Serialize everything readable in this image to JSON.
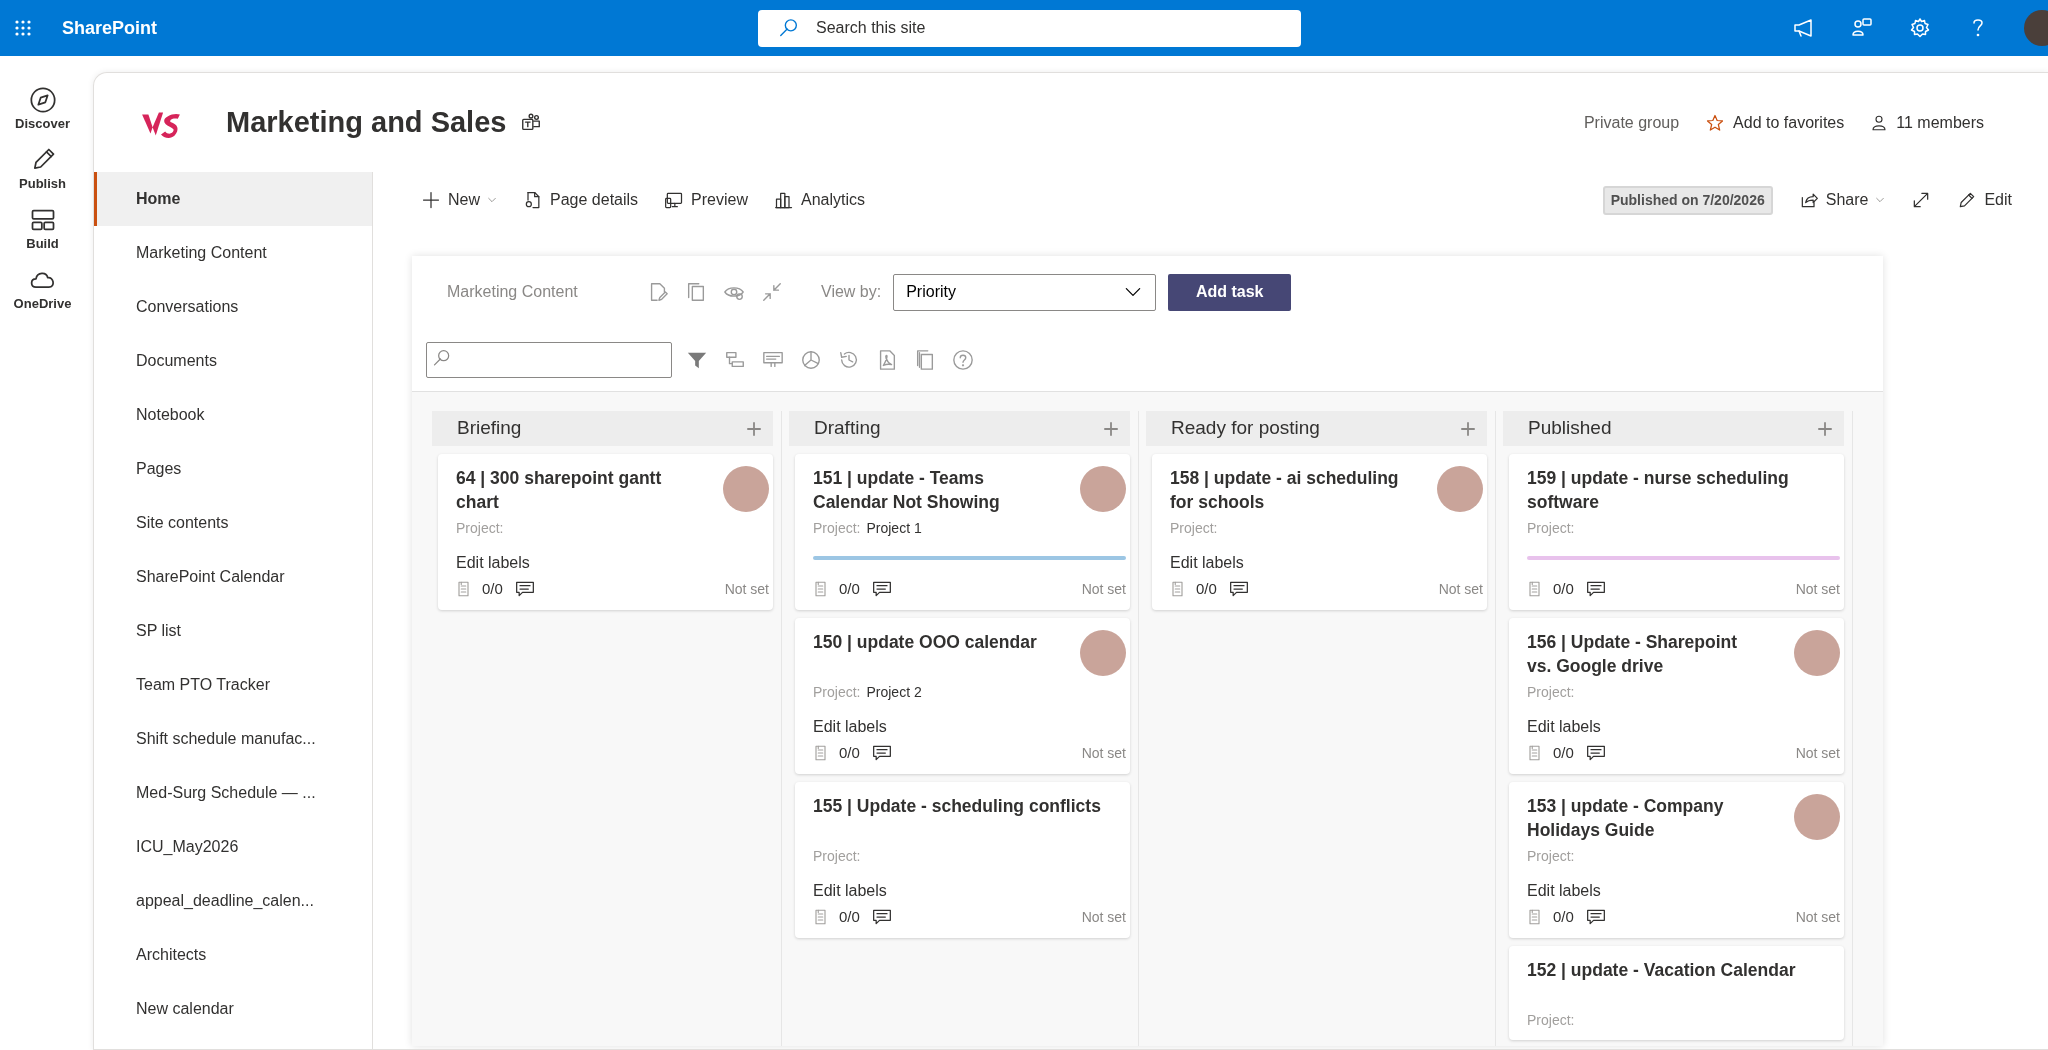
{
  "topbar": {
    "app_name": "SharePoint",
    "search_placeholder": "Search this site"
  },
  "rail": [
    {
      "label": "Discover",
      "kind": "discover"
    },
    {
      "label": "Publish",
      "kind": "publish"
    },
    {
      "label": "Build",
      "kind": "build"
    },
    {
      "label": "OneDrive",
      "kind": "onedrive"
    }
  ],
  "site": {
    "title": "Marketing and Sales",
    "privacy": "Private group",
    "favorite": "Add to favorites",
    "members": "11 members"
  },
  "nav": [
    {
      "label": "Home",
      "selected": true
    },
    {
      "label": "Marketing Content",
      "selected": false
    },
    {
      "label": "Conversations",
      "selected": false
    },
    {
      "label": "Documents",
      "selected": false
    },
    {
      "label": "Notebook",
      "selected": false
    },
    {
      "label": "Pages",
      "selected": false
    },
    {
      "label": "Site contents",
      "selected": false
    },
    {
      "label": "SharePoint Calendar",
      "selected": false
    },
    {
      "label": "SP list",
      "selected": false
    },
    {
      "label": "Team PTO Tracker",
      "selected": false
    },
    {
      "label": "Shift schedule manufac...",
      "selected": false
    },
    {
      "label": "Med-Surg Schedule — ...",
      "selected": false
    },
    {
      "label": "ICU_May2026",
      "selected": false
    },
    {
      "label": "appeal_deadline_calen...",
      "selected": false
    },
    {
      "label": "Architects",
      "selected": false
    },
    {
      "label": "New calendar",
      "selected": false
    }
  ],
  "commands": [
    {
      "label": "New",
      "kind": "new",
      "dropdown": true
    },
    {
      "label": "Page details",
      "kind": "details"
    },
    {
      "label": "Preview",
      "kind": "preview"
    },
    {
      "label": "Analytics",
      "kind": "analytics"
    }
  ],
  "page_status": "Published on 7/20/2026",
  "actions": [
    {
      "label": "Share",
      "kind": "share",
      "dropdown": true
    },
    {
      "kind": "expand"
    },
    {
      "label": "Edit",
      "kind": "edit"
    }
  ],
  "board": {
    "title": "Marketing Content",
    "view_by_label": "View by:",
    "view_by_value": "Priority",
    "add_task": "Add task",
    "columns": [
      {
        "title": "Briefing",
        "cards": [
          {
            "title": "64 | 300 sharepoint gantt chart",
            "avatar": true,
            "project_label": "Project:",
            "edit_labels": "Edit labels",
            "checklist": "0/0",
            "due": "Not set"
          }
        ]
      },
      {
        "title": "Drafting",
        "cards": [
          {
            "title": "151 | update - Teams Calendar Not Showing",
            "avatar": true,
            "project_label": "Project:",
            "project": "Project 1",
            "color": "#9cc6e4",
            "checklist": "0/0",
            "due": "Not set"
          },
          {
            "title": "150 | update OOO calendar",
            "avatar": true,
            "project_label": "Project:",
            "project": "Project 2",
            "edit_labels": "Edit labels",
            "checklist": "0/0",
            "due": "Not set"
          },
          {
            "title": "155 | Update - scheduling conflicts",
            "avatar": false,
            "project_label": "Project:",
            "edit_labels": "Edit labels",
            "checklist": "0/0",
            "due": "Not set"
          }
        ]
      },
      {
        "title": "Ready for posting",
        "cards": [
          {
            "title": "158 | update - ai scheduling for schools",
            "avatar": true,
            "project_label": "Project:",
            "edit_labels": "Edit labels",
            "checklist": "0/0",
            "due": "Not set"
          }
        ]
      },
      {
        "title": "Published",
        "cards": [
          {
            "title": "159 | update - nurse scheduling software",
            "avatar": false,
            "project_label": "Project:",
            "color": "#e8c2ec",
            "checklist": "0/0",
            "due": "Not set"
          },
          {
            "title": "156 | Update - Sharepoint vs. Google drive",
            "avatar": true,
            "project_label": "Project:",
            "edit_labels": "Edit labels",
            "checklist": "0/0",
            "due": "Not set"
          },
          {
            "title": "153 | update - Company Holidays Guide",
            "avatar": true,
            "project_label": "Project:",
            "edit_labels": "Edit labels",
            "checklist": "0/0",
            "due": "Not set"
          },
          {
            "title": "152 | update - Vacation Calendar",
            "avatar": false,
            "project_label": "Project:"
          }
        ]
      }
    ]
  }
}
